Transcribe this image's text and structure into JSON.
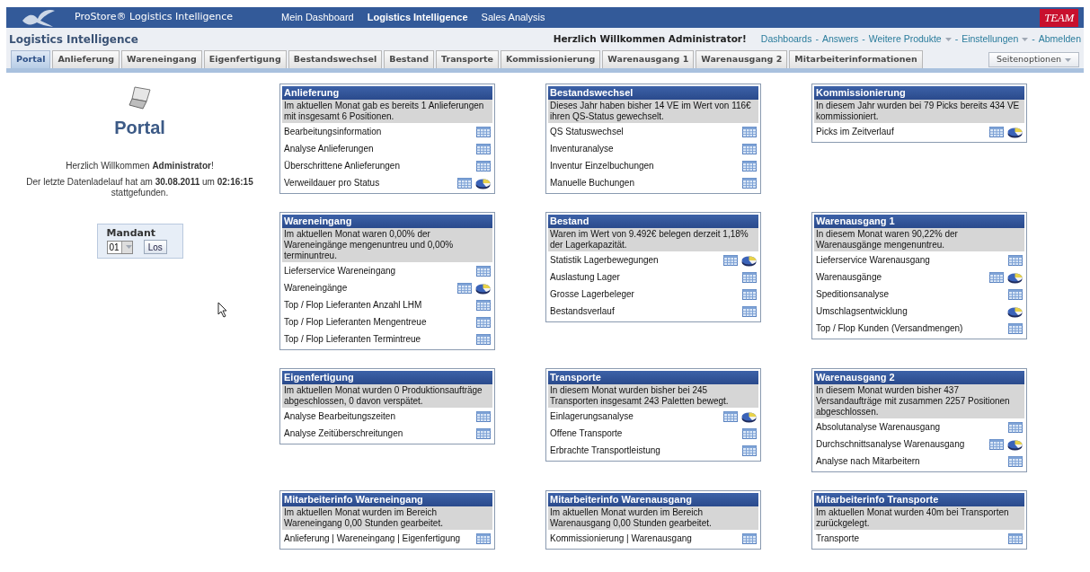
{
  "top_bar": {
    "product": "ProStore® Logistics Intelligence",
    "nav": [
      {
        "label": "Mein Dashboard",
        "selected": false
      },
      {
        "label": "Logistics Intelligence",
        "selected": true
      },
      {
        "label": "Sales Analysis",
        "selected": false
      }
    ],
    "logo_text": "TEAM"
  },
  "header": {
    "title": "Logistics Intelligence",
    "welcome": "Herzlich Willkommen Administrator!",
    "links": [
      {
        "label": "Dashboards",
        "dropdown": false
      },
      {
        "label": "Answers",
        "dropdown": false
      },
      {
        "label": "Weitere Produkte",
        "dropdown": true
      },
      {
        "label": "Einstellungen",
        "dropdown": true
      },
      {
        "label": "Abmelden",
        "dropdown": false
      }
    ],
    "separator": "-"
  },
  "tabs": [
    {
      "label": "Portal",
      "selected": true
    },
    {
      "label": "Anlieferung",
      "selected": false
    },
    {
      "label": "Wareneingang",
      "selected": false
    },
    {
      "label": "Eigenfertigung",
      "selected": false
    },
    {
      "label": "Bestandswechsel",
      "selected": false
    },
    {
      "label": "Bestand",
      "selected": false
    },
    {
      "label": "Transporte",
      "selected": false
    },
    {
      "label": "Kommissionierung",
      "selected": false
    },
    {
      "label": "Warenausgang 1",
      "selected": false
    },
    {
      "label": "Warenausgang 2",
      "selected": false
    },
    {
      "label": "Mitarbeiterinformationen",
      "selected": false
    }
  ],
  "page_options": "Seitenoptionen",
  "portal": {
    "title": "Portal",
    "welcome": "Herzlich Willkommen **Administrator**!",
    "last_load": "Der letzte Datenladelauf hat am **30.08.2011** um **02:16:15** stattgefunden.",
    "mandant_label": "Mandant",
    "mandant_value": "01",
    "go_button": "Los"
  },
  "cards": [
    {
      "title": "Anlieferung",
      "summary": "Im aktuellen Monat gab es bereits 1 Anlieferungen mit insgesamt 6 Positionen.",
      "items": [
        {
          "label": "Bearbeitungsinformation",
          "table": true,
          "chart": false
        },
        {
          "label": "Analyse Anlieferungen",
          "table": true,
          "chart": false
        },
        {
          "label": "Überschrittene Anlieferungen",
          "table": true,
          "chart": false
        },
        {
          "label": "Verweildauer pro Status",
          "table": true,
          "chart": true
        }
      ]
    },
    {
      "title": "Bestandswechsel",
      "summary": "Dieses Jahr haben bisher 14 VE im Wert von 116€ ihren QS-Status gewechselt.",
      "items": [
        {
          "label": "QS Statuswechsel",
          "table": true,
          "chart": false
        },
        {
          "label": "Inventuranalyse",
          "table": true,
          "chart": false
        },
        {
          "label": "Inventur Einzelbuchungen",
          "table": true,
          "chart": false
        },
        {
          "label": "Manuelle Buchungen",
          "table": true,
          "chart": false
        }
      ]
    },
    {
      "title": "Kommissionierung",
      "summary": "In diesem Jahr wurden bei 79 Picks bereits 434 VE kommissioniert.",
      "items": [
        {
          "label": "Picks im Zeitverlauf",
          "table": true,
          "chart": true
        }
      ]
    },
    {
      "title": "Wareneingang",
      "summary": "Im aktuellen Monat waren 0,00% der Wareneingänge mengenuntreu und 0,00% terminuntreu.",
      "items": [
        {
          "label": "Lieferservice Wareneingang",
          "table": true,
          "chart": false
        },
        {
          "label": "Wareneingänge",
          "table": true,
          "chart": true
        },
        {
          "label": "Top / Flop Lieferanten Anzahl LHM",
          "table": true,
          "chart": false
        },
        {
          "label": "Top / Flop Lieferanten Mengentreue",
          "table": true,
          "chart": false
        },
        {
          "label": "Top / Flop Lieferanten Termintreue",
          "table": true,
          "chart": false
        }
      ]
    },
    {
      "title": "Bestand",
      "summary": "Waren im Wert von 9.492€ belegen derzeit 1,18% der Lagerkapazität.",
      "items": [
        {
          "label": "Statistik Lagerbewegungen",
          "table": true,
          "chart": true
        },
        {
          "label": "Auslastung Lager",
          "table": true,
          "chart": false
        },
        {
          "label": "Grosse Lagerbeleger",
          "table": true,
          "chart": false
        },
        {
          "label": "Bestandsverlauf",
          "table": true,
          "chart": false
        }
      ]
    },
    {
      "title": "Warenausgang 1",
      "summary": "In diesem Monat waren 90,22% der Warenausgänge mengenuntreu.",
      "items": [
        {
          "label": "Lieferservice Warenausgang",
          "table": true,
          "chart": false
        },
        {
          "label": "Warenausgänge",
          "table": true,
          "chart": true
        },
        {
          "label": "Speditionsanalyse",
          "table": true,
          "chart": false
        },
        {
          "label": "Umschlagsentwicklung",
          "table": false,
          "chart": true
        },
        {
          "label": "Top / Flop Kunden (Versandmengen)",
          "table": true,
          "chart": false
        }
      ]
    },
    {
      "title": "Eigenfertigung",
      "summary": "Im aktuellen Monat wurden 0 Produktionsaufträge abgeschlossen, 0 davon verspätet.",
      "items": [
        {
          "label": "Analyse Bearbeitungszeiten",
          "table": true,
          "chart": false
        },
        {
          "label": "Analyse Zeitüberschreitungen",
          "table": true,
          "chart": false
        }
      ]
    },
    {
      "title": "Transporte",
      "summary": "In diesem Monat wurden bisher bei 245 Transporten insgesamt 243 Paletten bewegt.",
      "items": [
        {
          "label": "Einlagerungsanalyse",
          "table": true,
          "chart": true
        },
        {
          "label": "Offene Transporte",
          "table": true,
          "chart": false
        },
        {
          "label": "Erbrachte Transportleistung",
          "table": true,
          "chart": false
        }
      ]
    },
    {
      "title": "Warenausgang 2",
      "summary": "In diesem Monat wurden bisher 437 Versandaufträge mit zusammen 2257 Positionen abgeschlossen.",
      "items": [
        {
          "label": "Absolutanalyse Warenausgang",
          "table": true,
          "chart": false
        },
        {
          "label": "Durchschnittsanalyse Warenausgang",
          "table": true,
          "chart": true
        },
        {
          "label": "Analyse nach Mitarbeitern",
          "table": true,
          "chart": false
        }
      ]
    },
    {
      "title": "Mitarbeiterinfo Wareneingang",
      "summary": "Im aktuellen Monat wurden im Bereich Wareneingang 0,00 Stunden gearbeitet.",
      "items": [
        {
          "label": "Anlieferung | Wareneingang | Eigenfertigung",
          "table": true,
          "chart": false
        }
      ]
    },
    {
      "title": "Mitarbeiterinfo Warenausgang",
      "summary": "Im aktuellen Monat wurden im Bereich Warenausgang 0,00 Stunden gearbeitet.",
      "items": [
        {
          "label": "Kommissionierung | Warenausgang",
          "table": true,
          "chart": false
        }
      ]
    },
    {
      "title": "Mitarbeiterinfo Transporte",
      "summary": "Im aktuellen Monat wurden 40m bei Transporten zurückgelegt.",
      "items": [
        {
          "label": "Transporte",
          "table": true,
          "chart": false
        }
      ]
    }
  ]
}
